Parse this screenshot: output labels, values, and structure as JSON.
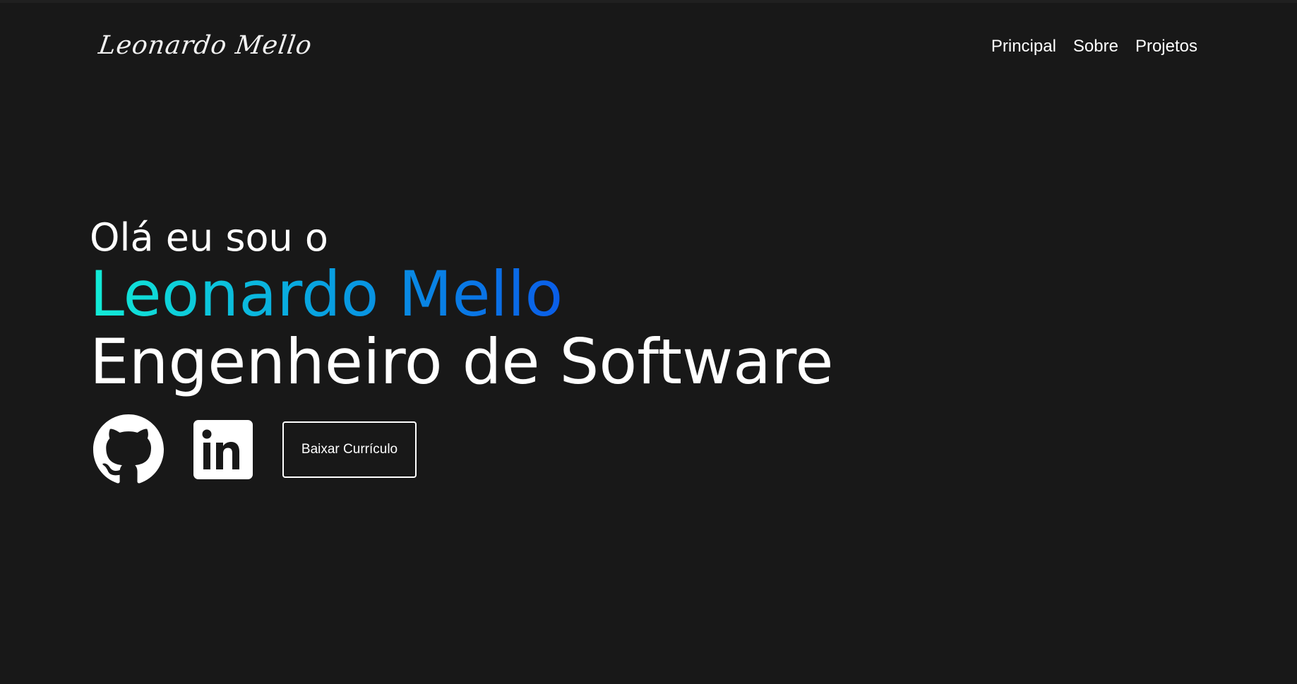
{
  "header": {
    "logo_text": "Leonardo Mello",
    "nav": [
      {
        "label": "Principal"
      },
      {
        "label": "Sobre"
      },
      {
        "label": "Projetos"
      }
    ]
  },
  "hero": {
    "greeting": "Olá eu sou o",
    "name": "Leonardo Mello",
    "role": "Engenheiro de Software",
    "name_gradient": [
      "#12ecd6",
      "#08a7e0",
      "#0a5de8"
    ]
  },
  "actions": {
    "github_icon": "github-icon",
    "linkedin_icon": "linkedin-icon",
    "resume_button_label": "Baixar Currículo"
  },
  "colors": {
    "background": "#181818",
    "text": "#ffffff"
  }
}
